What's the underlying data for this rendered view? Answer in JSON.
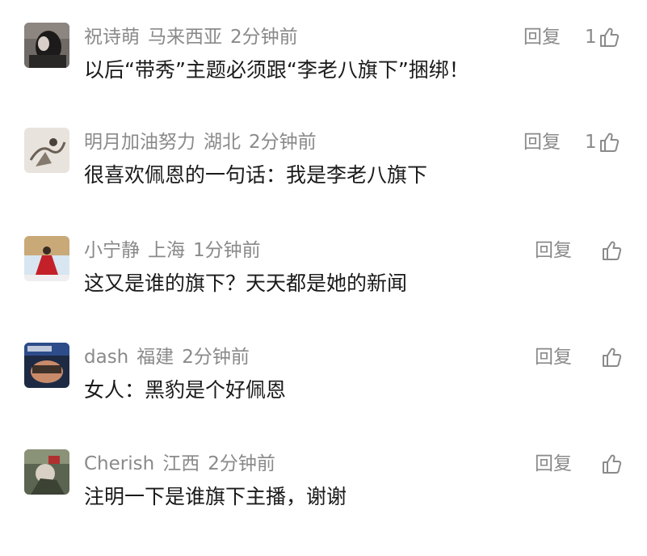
{
  "comments": [
    {
      "name": "祝诗萌",
      "location": "马来西亚",
      "time": "2分钟前",
      "text": "以后“带秀”主题必须跟“李老八旗下”捆绑！",
      "reply_label": "回复",
      "likes": "1",
      "avatar_icon": "avatar-dark-photo"
    },
    {
      "name": "明月加油努力",
      "location": "湖北",
      "time": "2分钟前",
      "text": "很喜欢佩恩的一句话：我是李老八旗下",
      "reply_label": "回复",
      "likes": "1",
      "avatar_icon": "avatar-sketch-photo"
    },
    {
      "name": "小宁静",
      "location": "上海",
      "time": "1分钟前",
      "text": "这又是谁的旗下？天天都是她的新闻",
      "reply_label": "回复",
      "likes": "",
      "avatar_icon": "avatar-red-dress-photo"
    },
    {
      "name": "dash",
      "location": "福建",
      "time": "2分钟前",
      "text": "女人：黑豹是个好佩恩",
      "reply_label": "回复",
      "likes": "",
      "avatar_icon": "avatar-helmet-photo"
    },
    {
      "name": "Cherish",
      "location": "江西",
      "time": "2分钟前",
      "text": "注明一下是谁旗下主播，谢谢",
      "reply_label": "回复",
      "likes": "",
      "avatar_icon": "avatar-green-photo"
    }
  ],
  "colors": {
    "meta": "#8a8a8a",
    "text": "#1a1a1a",
    "background": "#ffffff"
  }
}
